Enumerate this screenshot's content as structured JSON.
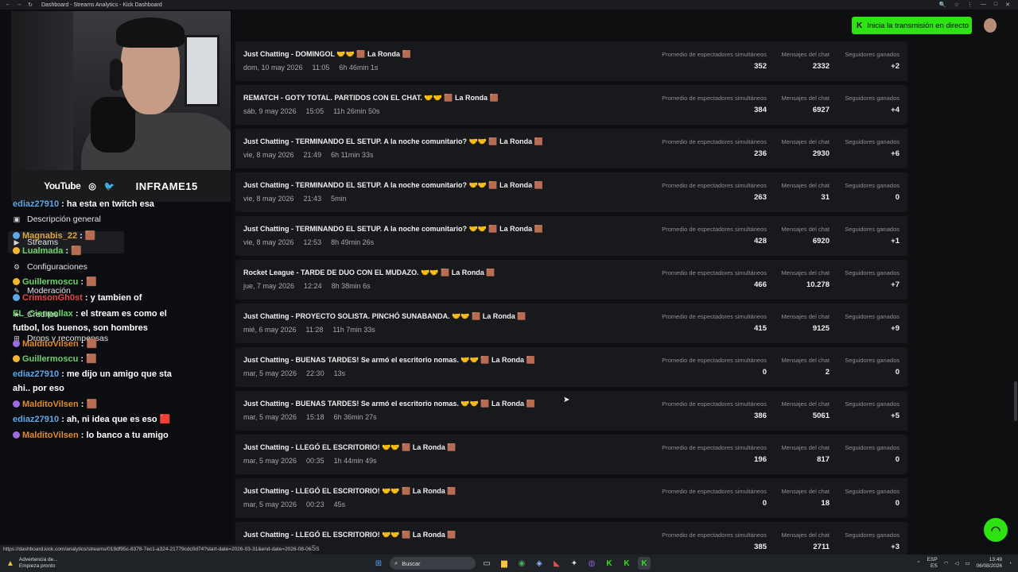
{
  "browser": {
    "tab_title": "Dashboard - Streams Analytics - Kick Dashboard",
    "nav_back": "←",
    "nav_forward": "→",
    "nav_reload": "↻",
    "right_icons": [
      "🔍",
      "☆",
      "⋮",
      "—",
      "□",
      "✕"
    ]
  },
  "sidebar": {
    "items": [
      {
        "label": "Descripción general",
        "icon": "dashboard-icon",
        "glyph": "▣"
      },
      {
        "label": "Streams",
        "icon": "streams-icon",
        "glyph": "▶"
      },
      {
        "label": "Configuraciones",
        "icon": "settings-icon",
        "glyph": "⚙"
      },
      {
        "label": "Moderación",
        "icon": "moderation-icon",
        "glyph": "✎"
      },
      {
        "label": "Creditos",
        "icon": "credits-icon",
        "glyph": "★"
      },
      {
        "label": "Drops y recompensas",
        "icon": "drops-icon",
        "glyph": "⊞"
      }
    ]
  },
  "webcam_overlay": {
    "social_youtube": "YouTube",
    "social_instagram_glyph": "◎",
    "social_twitter_glyph": "🐦",
    "handle": "INFRAME15"
  },
  "chat_overlay": {
    "lines": [
      {
        "user": "ediaz27910",
        "user_color": "#5fa8e8",
        "badge": "",
        "text": " : ha esta en twitch esa"
      },
      {
        "user": "Magnabis_22",
        "user_color": "#e0a63a",
        "badge": "blue",
        "text": " : 🟫"
      },
      {
        "user": "Lualmada",
        "user_color": "#6ed06a",
        "badge": "gold",
        "text": " : 🟫"
      },
      {
        "user": "Guillermoscu",
        "user_color": "#6ed06a",
        "badge": "gold",
        "text": " : 🟫"
      },
      {
        "user": "CrimsonGh0st",
        "user_color": "#e24848",
        "badge": "blue",
        "text": " : y tambien of"
      },
      {
        "user": "EL_Cienpollax",
        "user_color": "#6ed06a",
        "badge": "",
        "text": " : el stream es como el"
      },
      {
        "user": "",
        "user_color": "#ffffff",
        "badge": "",
        "text": "futbol, los buenos, son hombres"
      },
      {
        "user": "MalditoVilsen",
        "user_color": "#e08a2c",
        "badge": "purple",
        "text": " : 🟫"
      },
      {
        "user": "Guillermoscu",
        "user_color": "#6ed06a",
        "badge": "gold",
        "text": " : 🟫"
      },
      {
        "user": "ediaz27910",
        "user_color": "#5fa8e8",
        "badge": "",
        "text": " : me dijo un amigo que sta"
      },
      {
        "user": "",
        "user_color": "#ffffff",
        "badge": "",
        "text": "ahi.. por eso"
      },
      {
        "user": "MalditoVilsen",
        "user_color": "#e08a2c",
        "badge": "purple",
        "text": " : 🟫"
      },
      {
        "user": "ediaz27910",
        "user_color": "#5fa8e8",
        "badge": "",
        "text": " : ah, ni idea que es eso 🟥"
      },
      {
        "user": "MalditoVilsen",
        "user_color": "#e08a2c",
        "badge": "purple",
        "text": " : lo banco a tu amigo"
      }
    ]
  },
  "header": {
    "go_live_label": "Inicia la transmisión en directo",
    "go_live_icon": "K"
  },
  "stat_labels": {
    "viewers": "Promedio de espectadores simultáneos",
    "chat": "Mensajes del chat",
    "followers": "Seguidores ganados"
  },
  "streams": [
    {
      "title": "Just Chatting - DOMINGOL 🤝🤝 🟫 La Ronda 🟫",
      "date": "dom, 10 may 2026",
      "time": "11:05",
      "duration": "6h 46min 1s",
      "viewers": "352",
      "chat": "2332",
      "followers": "+2"
    },
    {
      "title": "REMATCH - GOTY TOTAL. PARTIDOS CON EL CHAT. 🤝🤝 🟫 La Ronda 🟫",
      "date": "sáb, 9 may 2026",
      "time": "15:05",
      "duration": "11h 26min 50s",
      "viewers": "384",
      "chat": "6927",
      "followers": "+4"
    },
    {
      "title": "Just Chatting - TERMINANDO EL SETUP. A la noche comunitario? 🤝🤝 🟫 La Ronda 🟫",
      "date": "vie, 8 may 2026",
      "time": "21:49",
      "duration": "6h 11min 33s",
      "viewers": "236",
      "chat": "2930",
      "followers": "+6"
    },
    {
      "title": "Just Chatting - TERMINANDO EL SETUP. A la noche comunitario? 🤝🤝 🟫 La Ronda 🟫",
      "date": "vie, 8 may 2026",
      "time": "21:43",
      "duration": "5min",
      "viewers": "263",
      "chat": "31",
      "followers": "0"
    },
    {
      "title": "Just Chatting - TERMINANDO EL SETUP. A la noche comunitario? 🤝🤝 🟫 La Ronda 🟫",
      "date": "vie, 8 may 2026",
      "time": "12:53",
      "duration": "8h 49min 26s",
      "viewers": "428",
      "chat": "6920",
      "followers": "+1"
    },
    {
      "title": "Rocket League - TARDE DE DUO CON EL MUDAZO. 🤝🤝 🟫 La Ronda 🟫",
      "date": "jue, 7 may 2026",
      "time": "12:24",
      "duration": "8h 38min 6s",
      "viewers": "466",
      "chat": "10.278",
      "followers": "+7"
    },
    {
      "title": "Just Chatting - PROYECTO SOLISTA. PINCHÓ SUNABANDA. 🤝🤝 🟫 La Ronda 🟫",
      "date": "mié, 6 may 2026",
      "time": "11:28",
      "duration": "11h 7min 33s",
      "viewers": "415",
      "chat": "9125",
      "followers": "+9"
    },
    {
      "title": "Just Chatting - BUENAS TARDES! Se armó el escritorio nomas. 🤝🤝 🟫 La Ronda 🟫",
      "date": "mar, 5 may 2026",
      "time": "22:30",
      "duration": "13s",
      "viewers": "0",
      "chat": "2",
      "followers": "0"
    },
    {
      "title": "Just Chatting - BUENAS TARDES! Se armó el escritorio nomas. 🤝🤝 🟫 La Ronda 🟫",
      "date": "mar, 5 may 2026",
      "time": "15:18",
      "duration": "6h 36min 27s",
      "viewers": "386",
      "chat": "5061",
      "followers": "+5"
    },
    {
      "title": "Just Chatting - LLEGÓ EL ESCRITORIO! 🤝🤝 🟫 La Ronda 🟫",
      "date": "mar, 5 may 2026",
      "time": "00:35",
      "duration": "1h 44min 49s",
      "viewers": "196",
      "chat": "817",
      "followers": "0"
    },
    {
      "title": "Just Chatting - LLEGÓ EL ESCRITORIO! 🤝🤝 🟫 La Ronda 🟫",
      "date": "mar, 5 may 2026",
      "time": "00:23",
      "duration": "45s",
      "viewers": "0",
      "chat": "18",
      "followers": "0"
    },
    {
      "title": "Just Chatting - LLEGÓ EL ESCRITORIO! 🤝🤝 🟫 La Ronda 🟫",
      "date": "",
      "time": "17:33",
      "duration": "6h 47min 5s",
      "viewers": "385",
      "chat": "2711",
      "followers": "+3"
    }
  ],
  "status_url": "https://dashboard.kick.com/analytics/streams/019df95c-8378-7ec1-a324-21779cdc0d74?start-date=2026-03-31&end-date=2026-08-06&filter=all",
  "taskbar": {
    "warning_title": "Advertencia de...",
    "warning_sub": "Empieza pronto",
    "search_placeholder": "Buscar",
    "lang_top": "ESP",
    "lang_bottom": "ES",
    "time": "13:49",
    "date": "06/08/2026",
    "accent": "#2ee312"
  }
}
